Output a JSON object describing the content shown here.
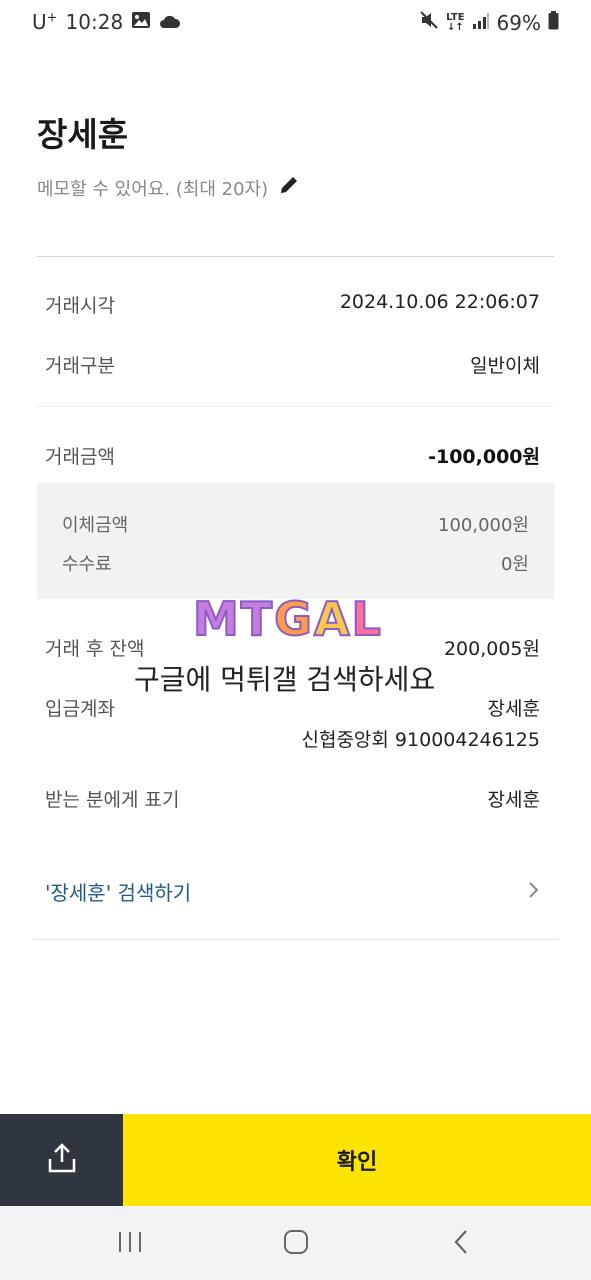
{
  "status_bar": {
    "carrier": "U",
    "carrier_plus": "+",
    "time": "10:28",
    "network": "LTE",
    "battery_percent": "69%"
  },
  "header": {
    "name": "장세훈",
    "memo_placeholder": "메모할 수 있어요. (최대 20자)"
  },
  "transaction": {
    "time_label": "거래시각",
    "time_value": "2024.10.06 22:06:07",
    "type_label": "거래구분",
    "type_value": "일반이체",
    "amount_label": "거래금액",
    "amount_value": "-100,000원",
    "transfer_label": "이체금액",
    "transfer_value": "100,000원",
    "fee_label": "수수료",
    "fee_value": "0원",
    "balance_label": "거래 후 잔액",
    "balance_value": "200,005원",
    "account_label": "입금계좌",
    "account_name": "장세훈",
    "account_number": "신협중앙회 910004246125",
    "display_label": "받는 분에게 표기",
    "display_value": "장세훈"
  },
  "search_link": "'장세훈' 검색하기",
  "watermark": {
    "logo": "MTGAL",
    "logo_m": "M",
    "logo_t": "T",
    "logo_g": "G",
    "logo_a": "A",
    "logo_l": "L",
    "text": "구글에 먹튀갤 검색하세요"
  },
  "bottom": {
    "confirm_label": "확인"
  },
  "icons": [
    "image-icon",
    "cloud-icon",
    "mute-icon",
    "signal-icon",
    "battery-icon",
    "pencil-icon",
    "chevron-right-icon",
    "share-icon",
    "recent-apps-icon",
    "home-icon",
    "back-icon"
  ]
}
